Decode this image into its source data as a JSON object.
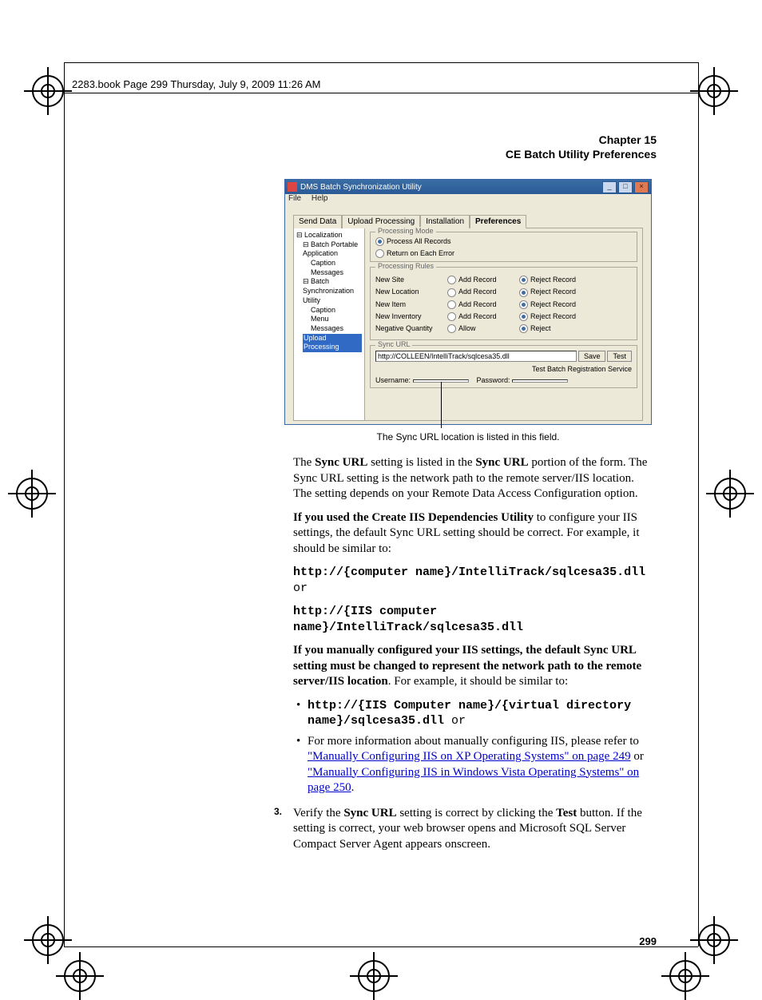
{
  "header": "2283.book  Page 299  Thursday, July 9, 2009  11:26 AM",
  "chapter_line1": "Chapter 15",
  "chapter_line2": "CE Batch Utility Preferences",
  "page_number": "299",
  "screenshot": {
    "title": "DMS Batch Synchronization Utility",
    "menu": {
      "file": "File",
      "help": "Help"
    },
    "tabs": {
      "send": "Send Data",
      "upload": "Upload Processing",
      "install": "Installation",
      "prefs": "Preferences"
    },
    "tree": {
      "root": "Localization",
      "bpa": "Batch Portable Application",
      "caption1": "Caption",
      "messages1": "Messages",
      "bsu": "Batch Synchronization Utility",
      "caption2": "Caption",
      "menu": "Menu",
      "messages2": "Messages",
      "up": "Upload Processing"
    },
    "processing_mode": {
      "legend": "Processing Mode",
      "opt1": "Process All Records",
      "opt2": "Return on Each Error"
    },
    "rules": {
      "legend": "Processing Rules",
      "addrec": "Add Record",
      "rejrec": "Reject Record",
      "allow": "Allow",
      "reject": "Reject",
      "rows": {
        "new_site": "New Site",
        "new_location": "New Location",
        "new_item": "New Item",
        "new_inventory": "New Inventory",
        "neg_qty": "Negative Quantity"
      }
    },
    "sync": {
      "legend": "Sync URL",
      "value": "http://COLLEEN/IntelliTrack/sqlcesa35.dll",
      "save": "Save",
      "test": "Test",
      "test_service": "Test Batch Registration Service",
      "username_lbl": "Username:",
      "password_lbl": "Password:"
    }
  },
  "caption": "The Sync URL location is listed in this field.",
  "body": {
    "p1_a": "The ",
    "p1_b": "Sync URL",
    "p1_c": " setting is listed in the ",
    "p1_d": "Sync URL",
    "p1_e": " portion of the form. The Sync URL setting is the network path to the remote server/IIS location. The setting depends on your Remote Data Access Configuration option.",
    "p2_a": "If you used the Create IIS Dependencies Utility",
    "p2_b": " to configure your IIS settings, the default Sync URL setting should be correct. For example, it should be similar to:",
    "url1": "http://{computer name}/IntelliTrack/sqlcesa35.dll",
    "or": " or",
    "url2": "http://{IIS computer name}/IntelliTrack/sqlcesa35.dll",
    "p3_a": "If you manually configured your IIS settings, the default Sync URL setting must be changed to represent the network path to the remote server/IIS location",
    "p3_b": ". For example, it should be similar to:",
    "bullet1": "http://{IIS Computer name}/{virtual directory name}/sqlcesa35.dll",
    "bullet2_a": "For more information about manually configuring IIS, please refer to ",
    "link1": "\"Manually Configuring IIS on XP Operating Systems\" on page 249",
    "mid": " or ",
    "link2": "\"Manually Configuring IIS in Windows Vista Operating Systems\" on page 250",
    "end": ".",
    "step3_a": "Verify the ",
    "step3_b": "Sync URL",
    "step3_c": " setting is correct by clicking the ",
    "step3_d": "Test",
    "step3_e": " button. If the setting is correct, your web browser opens and Microsoft SQL Server Compact Server Agent appears onscreen.",
    "step_num": "3."
  }
}
